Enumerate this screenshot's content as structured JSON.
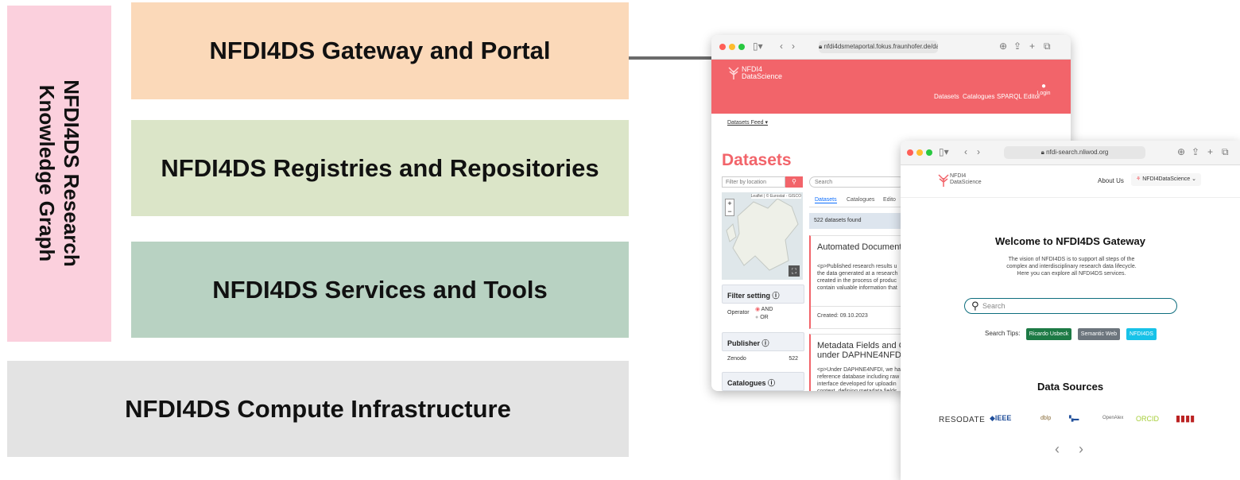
{
  "layers": {
    "kg_line1": "NFDI4DS Research",
    "kg_line2": "Knowledge Graph",
    "gateway": "NFDI4DS Gateway and Portal",
    "registries": "NFDI4DS Registries and Repositories",
    "services": "NFDI4DS Services and Tools",
    "compute": "NFDI4DS Compute Infrastructure"
  },
  "colors": {
    "kg": "#fbd0dd",
    "gateway": "#fbd9b9",
    "registries": "#dbe5c8",
    "services": "#b8d2c2",
    "compute": "#e3e3e3",
    "portal_accent": "#f2646a",
    "tip_green": "#1d7a45",
    "tip_gray": "#6c757d",
    "tip_cyan": "#17c2e8"
  },
  "portal": {
    "url": "nfdi4dsmetaportal.fokus.fraunhofer.de/dat",
    "logo_line1": "NFDI4",
    "logo_line2": "DataScience",
    "nav": [
      "Datasets",
      "Catalogues",
      "SPARQL Editor"
    ],
    "login": "Login",
    "breadcrumb": "Datasets Feed",
    "page_title": "Datasets",
    "location_placeholder": "Filter by location",
    "search_placeholder": "Search",
    "map_attribution": "Leaflet | © Eurostat - GISCO",
    "tabs": [
      "Datasets",
      "Catalogues",
      "Edito"
    ],
    "count": "522 datasets found",
    "filter_setting": "Filter setting",
    "operator_label": "Operator",
    "op_and": "AND",
    "op_or": "OR",
    "publisher": "Publisher",
    "publisher_name": "Zenodo",
    "publisher_count": "522",
    "catalogues": "Catalogues",
    "card1_title": "Automated Documenta",
    "card1_text": "<p>Published research results u the data generated at a research created in the process of produc contain valuable information that",
    "card1_created": "Created: 09.10.2023",
    "card2_title_1": "Metadata Fields and Q",
    "card2_title_2": "under DAPHNE4NFDI",
    "card2_text": "<p>Under DAPHNE4NFDI, we ha reference database including raw interface developed for uploadin context, defining metadata fields"
  },
  "gateway_site": {
    "url": "nfdi-search.nliwod.org",
    "logo_line1": "NFDI4",
    "logo_line2": "DataScience",
    "about": "About Us",
    "org_dropdown": "NFDI4DataScience",
    "welcome": "Welcome to NFDI4DS Gateway",
    "intro": "The vision of NFDI4DS is to support all steps of the complex and interdisciplinary research data lifecycle. Here you can explore all NFDI4DS services.",
    "search_placeholder": "Search",
    "tips_label": "Search Tips:",
    "tips": [
      "Ricardo Usbeck",
      "Semantic Web",
      "NFDI4DS"
    ],
    "sources_title": "Data Sources",
    "source_logos": [
      "RESODATE",
      "IEEE",
      "dblp",
      "OpenAlex",
      "ORCID"
    ]
  }
}
